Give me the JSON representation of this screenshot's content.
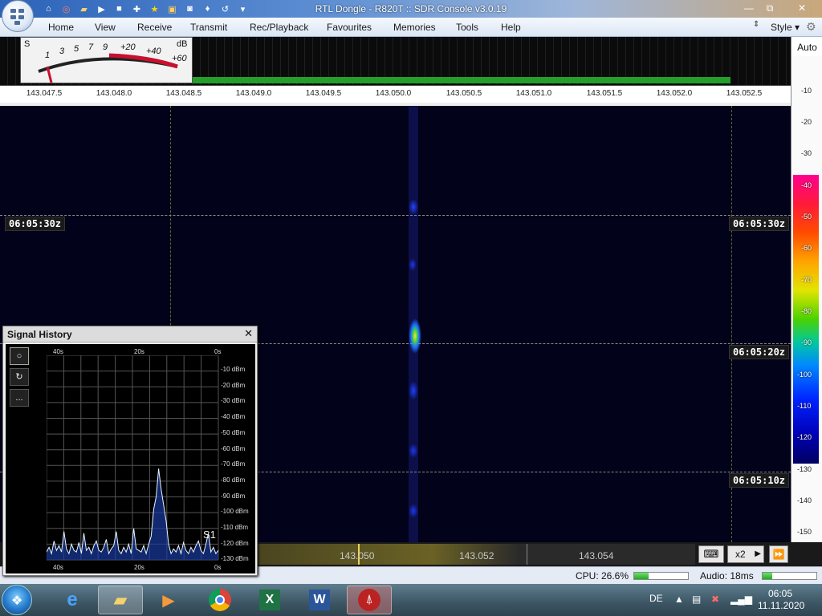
{
  "window": {
    "title": "RTL Dongle - R820T :: SDR Console v3.0.19",
    "min_glyph": "—",
    "max_glyph": "⧉",
    "close_glyph": "✕"
  },
  "qat_icons": [
    "home-icon",
    "lifebuoy-icon",
    "folder-icon",
    "play-icon",
    "stop-icon",
    "plus-icon",
    "star-icon",
    "lock-icon",
    "camera-icon",
    "drop-icon",
    "back-icon",
    "dropdown-icon"
  ],
  "menu": {
    "items": [
      "Home",
      "View",
      "Receive",
      "Transmit",
      "Rec/Playback",
      "Favourites",
      "Memories",
      "Tools",
      "Help"
    ],
    "style_label": "Style"
  },
  "smeter": {
    "s_label": "S",
    "db_label": "dB",
    "scale_labels": [
      "1",
      "3",
      "5",
      "7",
      "9",
      "+20",
      "+40",
      "+60"
    ]
  },
  "freq_axis": {
    "ticks": [
      "143.047.5",
      "143.048.0",
      "143.048.5",
      "143.049.0",
      "143.049.5",
      "143.050.0",
      "143.050.5",
      "143.051.0",
      "143.051.5",
      "143.052.0",
      "143.052.5"
    ]
  },
  "waterfall": {
    "time_labels": [
      "06:05:30z",
      "06:05:20z",
      "06:05:10z"
    ]
  },
  "right_scale": {
    "auto_label": "Auto",
    "db_ticks": [
      "-10",
      "-20",
      "-30",
      "-40",
      "-50",
      "-60",
      "-70",
      "-80",
      "-90",
      "-100",
      "-110",
      "-120",
      "-130",
      "-140",
      "-150"
    ]
  },
  "bottom_bar": {
    "ruler_freqs": [
      "143.050",
      "143.052",
      "143.054"
    ],
    "zoom_label": "x2"
  },
  "status_bar": {
    "cpu_label": "CPU: 26.6%",
    "cpu_fraction": 0.27,
    "audio_label": "Audio: 18ms",
    "audio_fraction": 0.18
  },
  "signal_history": {
    "title": "Signal History",
    "close_glyph": "✕",
    "tool_glyphs": [
      "○",
      "↻",
      "..."
    ],
    "top_time_labels": [
      "40s",
      "20s",
      "0s"
    ],
    "bottom_time_labels": [
      "40s",
      "20s",
      "0s"
    ],
    "y_labels": [
      "-10 dBm",
      "-20 dBm",
      "-30 dBm",
      "-40 dBm",
      "-50 dBm",
      "-60 dBm",
      "-70 dBm",
      "-80 dBm",
      "-90 dBm",
      "-100 dBm",
      "-110 dBm",
      "-120 dBm",
      "-130 dBm"
    ],
    "s_reading": "S1",
    "trace_dbm": [
      -125,
      -122,
      -126,
      -118,
      -124,
      -121,
      -125,
      -112,
      -123,
      -126,
      -120,
      -124,
      -125,
      -119,
      -126,
      -113,
      -124,
      -122,
      -126,
      -121,
      -118,
      -124,
      -125,
      -122,
      -117,
      -126,
      -123,
      -121,
      -112,
      -124,
      -126,
      -122,
      -125,
      -120,
      -126,
      -110,
      -123,
      -124,
      -125,
      -121,
      -126,
      -120,
      -115,
      -98,
      -90,
      -72,
      -85,
      -95,
      -105,
      -120,
      -126,
      -123,
      -125,
      -121,
      -126,
      -119,
      -124,
      -126,
      -122,
      -125,
      -121,
      -118,
      -124,
      -126,
      -120,
      -113,
      -125,
      -122,
      -126,
      -124
    ]
  },
  "taskbar": {
    "apps": [
      "ie-icon",
      "explorer-icon",
      "media-player-icon",
      "chrome-icon",
      "excel-icon",
      "word-icon",
      "sdr-console-icon"
    ],
    "lang": "DE",
    "time": "06:05",
    "date": "11.11.2020"
  }
}
